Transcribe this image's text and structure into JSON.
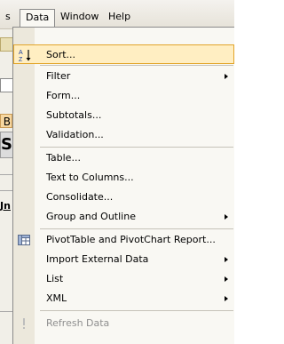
{
  "menubar": {
    "cut_label": "s",
    "data_label": "Data",
    "window_label": "Window",
    "help_label": "Help"
  },
  "background": {
    "cell_b": "B",
    "cell_s": "S",
    "cell_jn": "Jn"
  },
  "menu": {
    "items": [
      {
        "label": "Sort...",
        "icon": "sort-ascending-icon",
        "submenu": false
      },
      {
        "label": "Filter",
        "submenu": true
      },
      {
        "label": "Form...",
        "submenu": false
      },
      {
        "label": "Subtotals...",
        "submenu": false
      },
      {
        "label": "Validation...",
        "submenu": false
      },
      {
        "label": "Table...",
        "submenu": false
      },
      {
        "label": "Text to Columns...",
        "submenu": false
      },
      {
        "label": "Consolidate...",
        "submenu": false
      },
      {
        "label": "Group and Outline",
        "submenu": true
      },
      {
        "label": "PivotTable and PivotChart Report...",
        "icon": "pivottable-icon",
        "submenu": false
      },
      {
        "label": "Import External Data",
        "submenu": true
      },
      {
        "label": "List",
        "submenu": true
      },
      {
        "label": "XML",
        "submenu": true
      },
      {
        "label": "Refresh Data",
        "icon": "refresh-icon",
        "submenu": false,
        "disabled": true
      }
    ]
  },
  "colors": {
    "highlight_bg": "#ffeec2",
    "highlight_border": "#e2a52a",
    "menu_bg": "#f9f8f3",
    "icon_column": "#ece8dc"
  }
}
